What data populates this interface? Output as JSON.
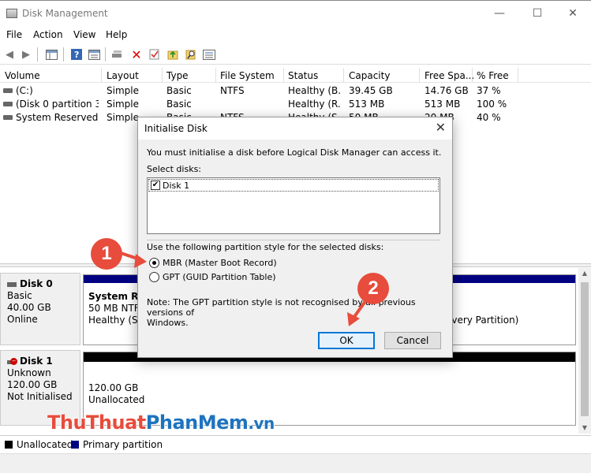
{
  "window": {
    "title": "Disk Management",
    "minimize_glyph": "—",
    "maximize_glyph": "☐",
    "close_glyph": "✕"
  },
  "menu": [
    {
      "label": "File"
    },
    {
      "label": "Action"
    },
    {
      "label": "View"
    },
    {
      "label": "Help"
    }
  ],
  "toolbar": {
    "icons": [
      "back-arrow-icon",
      "forward-arrow-icon",
      "console-tree-icon",
      "help-icon",
      "properties-icon",
      "connect-icon",
      "delete-icon",
      "check-icon",
      "up-folder-icon",
      "search-icon",
      "list-icon"
    ]
  },
  "volumes": {
    "columns": [
      "Volume",
      "Layout",
      "Type",
      "File System",
      "Status",
      "Capacity",
      "Free Spa...",
      "% Free"
    ],
    "rows": [
      [
        "(C:)",
        "Simple",
        "Basic",
        "NTFS",
        "Healthy (B...",
        "39.45 GB",
        "14.76 GB",
        "37 %"
      ],
      [
        "(Disk 0 partition 3)",
        "Simple",
        "Basic",
        "",
        "Healthy (R...",
        "513 MB",
        "513 MB",
        "100 %"
      ],
      [
        "System Reserved",
        "Simple",
        "Basic",
        "NTFS",
        "Healthy (S...",
        "50 MB",
        "20 MB",
        "40 %"
      ]
    ]
  },
  "disks": [
    {
      "name": "Disk 0",
      "type": "Basic",
      "size": "40.00 GB",
      "state": "Online",
      "partition_title": "System Res",
      "partition_line2": "50 MB NTFS",
      "partition_line3": "Healthy (Sys",
      "right_partition_text": "overy Partition)"
    },
    {
      "name": "Disk 1",
      "type": "Unknown",
      "size": "120.00 GB",
      "state": "Not Initialised",
      "partition_size": "120.00 GB",
      "partition_state": "Unallocated"
    }
  ],
  "legend": [
    {
      "label": "Unallocated",
      "color": "#000000"
    },
    {
      "label": "Primary partition",
      "color": "#000080"
    }
  ],
  "watermark": {
    "part1": "ThuThuat",
    "part2": "PhanMem",
    "part3": ".vn"
  },
  "dialog": {
    "title": "Initialise Disk",
    "message": "You must initialise a disk before Logical Disk Manager can access it.",
    "select_label": "Select disks:",
    "disk_item": "Disk 1",
    "partition_prompt": "Use the following partition style for the selected disks:",
    "option_mbr": "MBR (Master Boot Record)",
    "option_gpt": "GPT (GUID Partition Table)",
    "note_line1": "Note: The GPT partition style is not recognised by all previous versions of",
    "note_line2": "Windows.",
    "ok_label": "OK",
    "cancel_label": "Cancel"
  },
  "annotations": {
    "step1": "1",
    "step2": "2"
  },
  "colors": {
    "accent": "#0078d7",
    "primary_partition": "#000080",
    "annotation": "#e74c3c"
  }
}
